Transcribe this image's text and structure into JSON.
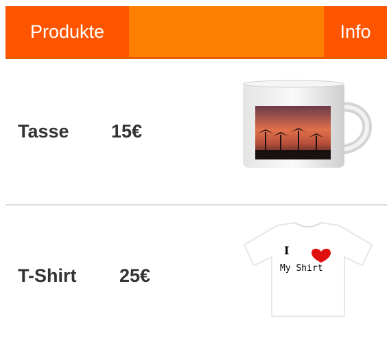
{
  "tabs": {
    "products_label": "Produkte",
    "info_label": "Info"
  },
  "colors": {
    "tab_bar": "#ff8000",
    "active_tab": "#ff5500",
    "text_dark": "#333333",
    "divider": "#dcdcdc"
  },
  "products": [
    {
      "name": "Tasse",
      "price": "15€",
      "image_icon": "mug-icon"
    },
    {
      "name": "T-Shirt",
      "price": "25€",
      "image_icon": "tshirt-icon",
      "print_top": "I",
      "print_bottom": "My Shirt"
    }
  ]
}
